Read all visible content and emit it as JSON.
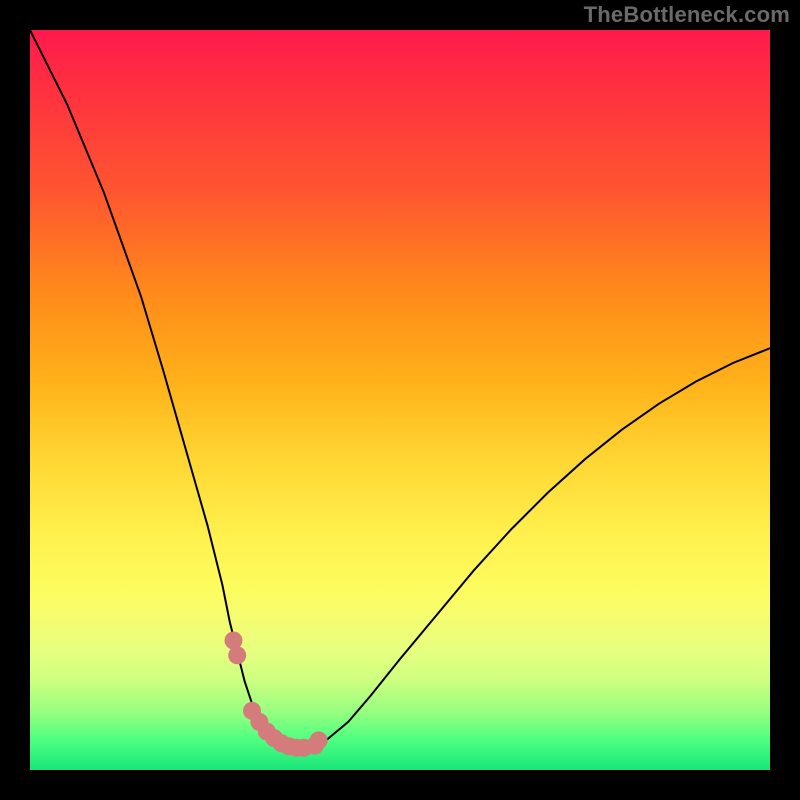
{
  "watermark": {
    "text": "TheBottleneck.com"
  },
  "chart_data": {
    "type": "line",
    "title": "",
    "xlabel": "",
    "ylabel": "",
    "xlim": [
      0,
      100
    ],
    "ylim": [
      0,
      100
    ],
    "grid": false,
    "legend": false,
    "series": [
      {
        "name": "bottleneck-curve",
        "x": [
          0,
          5,
          10,
          15,
          18,
          20,
          22,
          24,
          26,
          27,
          28,
          29,
          30,
          31,
          32,
          33,
          34,
          35,
          36,
          37,
          38,
          40,
          43,
          46,
          50,
          55,
          60,
          65,
          70,
          75,
          80,
          85,
          90,
          95,
          100
        ],
        "values": [
          100,
          90,
          78,
          64,
          54,
          47,
          40,
          33,
          25,
          20,
          16,
          12,
          9,
          7,
          5.5,
          4.5,
          3.8,
          3.3,
          3.0,
          3.0,
          3.2,
          4.0,
          6.5,
          10,
          15,
          21,
          27,
          32.5,
          37.5,
          42,
          46,
          49.5,
          52.5,
          55,
          57
        ]
      },
      {
        "name": "highlight-dots",
        "x": [
          27.5,
          28.0,
          30.0,
          31.0,
          32.0,
          33.0,
          34.0,
          35.0,
          36.0,
          37.0,
          38.5,
          39.0
        ],
        "values": [
          17.5,
          15.5,
          8.0,
          6.5,
          5.2,
          4.3,
          3.6,
          3.2,
          3.0,
          3.0,
          3.3,
          4.0
        ]
      }
    ],
    "highlight_color": "#d47b7b",
    "curve_color": "#000000"
  }
}
